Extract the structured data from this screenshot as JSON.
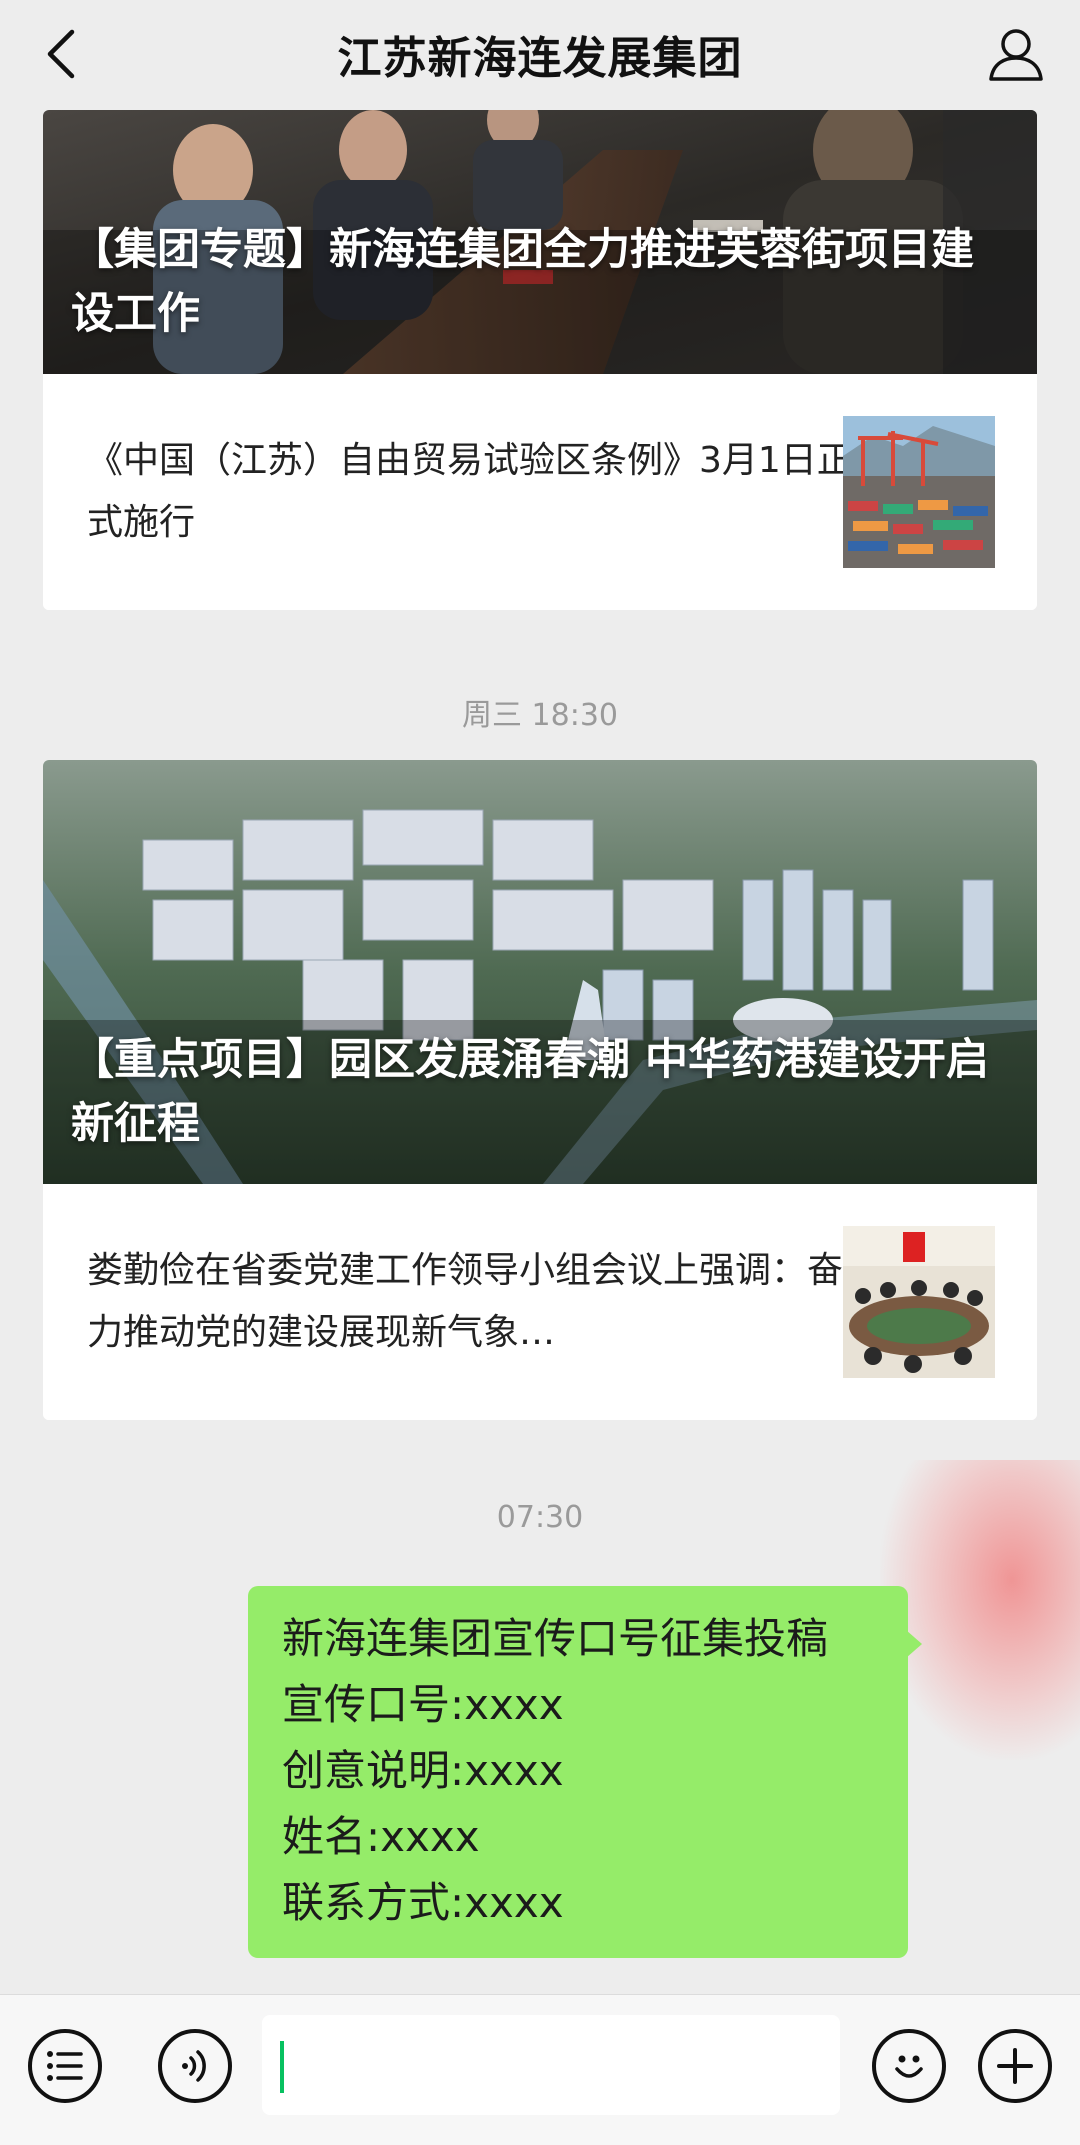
{
  "header": {
    "title": "江苏新海连发展集团",
    "back_icon": "chevron-left-icon",
    "profile_icon": "person-icon"
  },
  "articles": [
    {
      "main_title": "【集团专题】新海连集团全力推进芙蓉街项目建设工作",
      "sub_title": "《中国（江苏）自由贸易试验区条例》3月1日正式施行"
    },
    {
      "timestamp": "周三 18:30",
      "main_title": "【重点项目】园区发展涌春潮 中华药港建设开启新征程",
      "sub_title": "娄勤俭在省委党建工作领导小组会议上强调：奋力推动党的建设展现新气象…"
    }
  ],
  "message": {
    "timestamp": "07:30",
    "lines": [
      "新海连集团宣传口号征集投稿",
      "宣传口号:xxxx",
      "创意说明:xxxx",
      "姓名:xxxx",
      "联系方式:xxxx"
    ],
    "bubble_color": "#95ec69"
  },
  "input_bar": {
    "menu_icon": "menu-list-icon",
    "voice_icon": "voice-icon",
    "emoji_icon": "emoji-icon",
    "add_icon": "plus-icon",
    "caret_color": "#07c160"
  }
}
